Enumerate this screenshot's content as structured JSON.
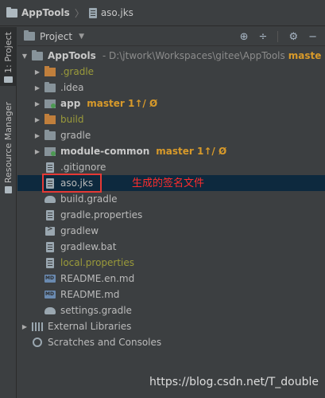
{
  "breadcrumb": {
    "project": "AppTools",
    "file": "aso.jks"
  },
  "sidebar": {
    "project_tab": "1: Project",
    "resource_tab": "Resource Manager"
  },
  "toolbar": {
    "title": "Project"
  },
  "tree": {
    "root": {
      "name": "AppTools",
      "path": "- D:\\jtwork\\Workspaces\\gitee\\AppTools",
      "branch": "maste"
    },
    "items": [
      {
        "label": ".gradle"
      },
      {
        "label": ".idea"
      },
      {
        "label": "app",
        "branch": "master 1↑/ Ø"
      },
      {
        "label": "build"
      },
      {
        "label": "gradle"
      },
      {
        "label": "module-common",
        "branch": "master 1↑/ Ø"
      },
      {
        "label": ".gitignore"
      },
      {
        "label": "aso.jks"
      },
      {
        "label": "build.gradle"
      },
      {
        "label": "gradle.properties"
      },
      {
        "label": "gradlew"
      },
      {
        "label": "gradlew.bat"
      },
      {
        "label": "local.properties"
      },
      {
        "label": "README.en.md"
      },
      {
        "label": "README.md"
      },
      {
        "label": "settings.gradle"
      }
    ],
    "external_libraries": "External Libraries",
    "scratches": "Scratches and Consoles"
  },
  "annotation": "生成的签名文件",
  "watermark": "https://blog.csdn.net/T_double",
  "colors": {
    "background": "#3c3f41",
    "selection": "#0d293e",
    "highlight_box": "#e53935",
    "annotation": "#ff2d2d",
    "branch": "#d89a2a"
  }
}
